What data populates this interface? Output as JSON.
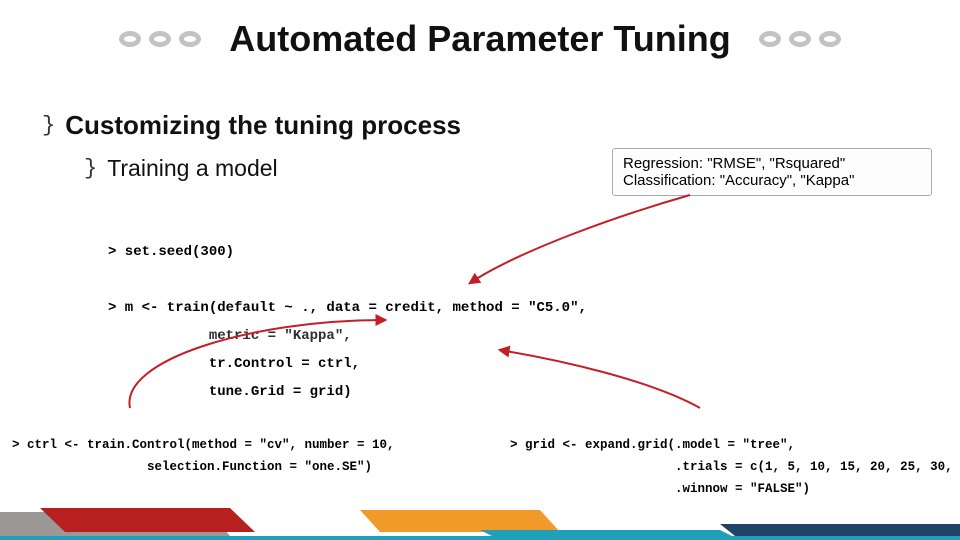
{
  "title": "Automated Parameter Tuning",
  "bullets": {
    "main": "Customizing the tuning process",
    "sub": "Training a model"
  },
  "note": {
    "line1": "Regression: \"RMSE\", \"Rsquared\"",
    "line2": "Classification: \"Accuracy\", \"Kappa\""
  },
  "code": {
    "main_l1": "> set.seed(300)",
    "main_l2": "> m <- train(default ~ ., data = credit, method = \"C5.0\",",
    "main_l3": "            metric = \"Kappa\",",
    "main_l4": "            tr.Control = ctrl,",
    "main_l5": "            tune.Grid = grid)",
    "ctrl_l1": "> ctrl <- train.Control(method = \"cv\", number = 10,",
    "ctrl_l2": "                  selection.Function = \"one.SE\")",
    "grid_l1": "> grid <- expand.grid(.model = \"tree\",",
    "grid_l2": "                      .trials = c(1, 5, 10, 15, 20, 25, 30, 35),",
    "grid_l3": "                      .winnow = \"FALSE\")"
  },
  "colors": {
    "ring": "#c4c3c3",
    "arrow": "#c22026",
    "footer": {
      "gray": "#9b9896",
      "red": "#b8201f",
      "orange": "#f29a29",
      "teal": "#1ea0bb",
      "navy": "#204367"
    }
  }
}
